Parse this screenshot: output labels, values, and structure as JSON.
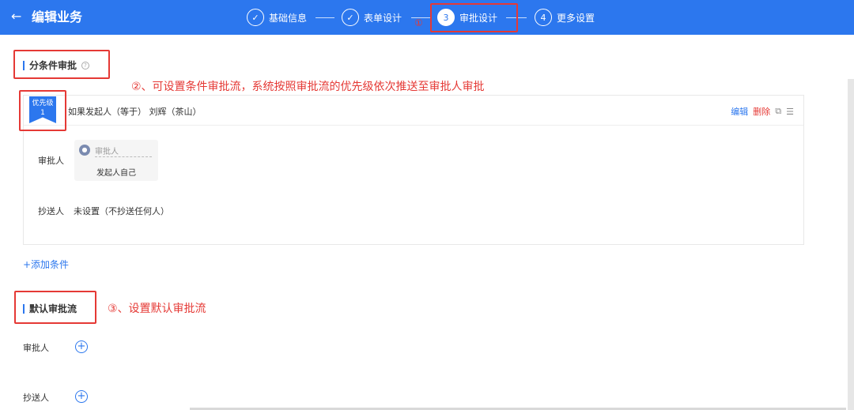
{
  "header": {
    "back_icon": "arrow-left-icon",
    "title": "编辑业务",
    "steps": [
      {
        "label": "基础信息",
        "marker": "✓"
      },
      {
        "label": "表单设计",
        "marker": "✓"
      },
      {
        "label": "审批设计",
        "marker": "3"
      },
      {
        "label": "更多设置",
        "marker": "4"
      }
    ],
    "active_step": 3
  },
  "annotations": {
    "note1": "①",
    "note2": "②、可设置条件审批流，系统按照审批流的优先级依次推送至审批人审批",
    "note3": "③、设置默认审批流"
  },
  "conditional_section": {
    "title": "分条件审批",
    "help_icon": "?",
    "card": {
      "priority_label": "优先级",
      "priority_value": "1",
      "condition_text": "如果发起人（等于） 刘辉（茶山）",
      "actions": {
        "edit": "编辑",
        "delete": "删除",
        "copy_icon": "copy-icon",
        "sort_icon": "sort-icon"
      },
      "approver_label": "审批人",
      "approver_placeholder": "审批人",
      "approver_value": "发起人自己",
      "cc_label": "抄送人",
      "cc_value": "未设置（不抄送任何人）"
    },
    "add_condition": "+添加条件"
  },
  "default_section": {
    "title": "默认审批流",
    "approver_label": "审批人",
    "cc_label": "抄送人"
  },
  "colors": {
    "brand": "#2c77ee",
    "annotation": "#e53935"
  }
}
